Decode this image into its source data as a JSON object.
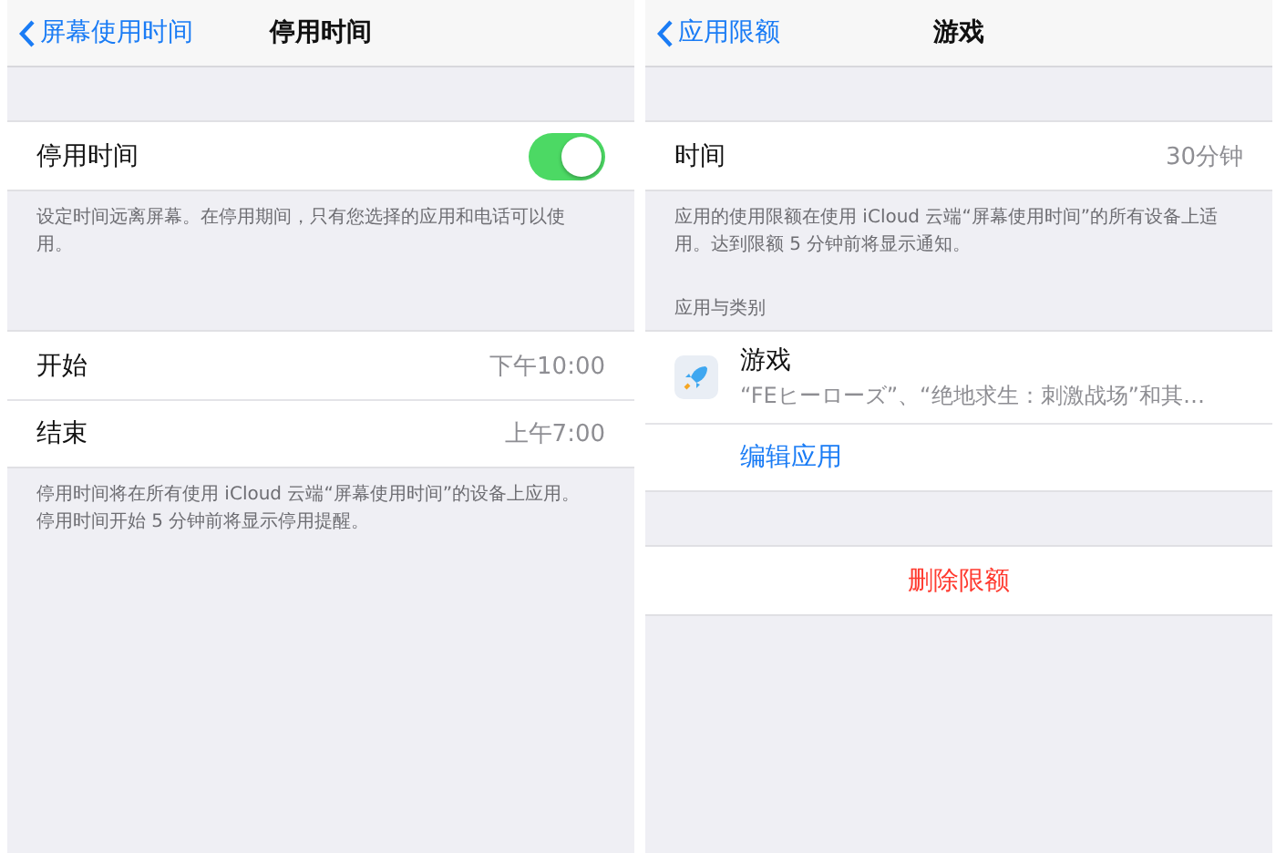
{
  "screens": [
    {
      "nav": {
        "back": "屏幕使用时间",
        "title": "停用时间"
      },
      "groups": [
        {
          "rows": [
            {
              "kind": "toggle",
              "label": "停用时间",
              "on": true
            }
          ],
          "footer": "设定时间远离屏幕。在停用期间，只有您选择的应用和电话可以使用。"
        },
        {
          "rows": [
            {
              "kind": "value",
              "label": "开始",
              "value": "下午10:00"
            },
            {
              "kind": "value",
              "label": "结束",
              "value": "上午7:00"
            }
          ],
          "footer": "停用时间将在所有使用 iCloud 云端“屏幕使用时间”的设备上应用。停用时间开始 5 分钟前将显示停用提醒。"
        }
      ]
    },
    {
      "nav": {
        "back": "应用限额",
        "title": "游戏"
      },
      "groups": [
        {
          "rows": [
            {
              "kind": "value",
              "label": "时间",
              "value": "30分钟"
            }
          ],
          "footer": "应用的使用限额在使用 iCloud 云端“屏幕使用时间”的所有设备上适用。达到限额 5 分钟前将显示通知。"
        },
        {
          "header": "应用与类别",
          "rows": [
            {
              "kind": "app",
              "label": "游戏",
              "detail": "“FEヒーローズ”、“绝地求生：刺激战场”和其…"
            },
            {
              "kind": "link",
              "label": "编辑应用"
            }
          ]
        },
        {
          "rows": [
            {
              "kind": "destructive",
              "label": "删除限额"
            }
          ]
        }
      ]
    }
  ]
}
